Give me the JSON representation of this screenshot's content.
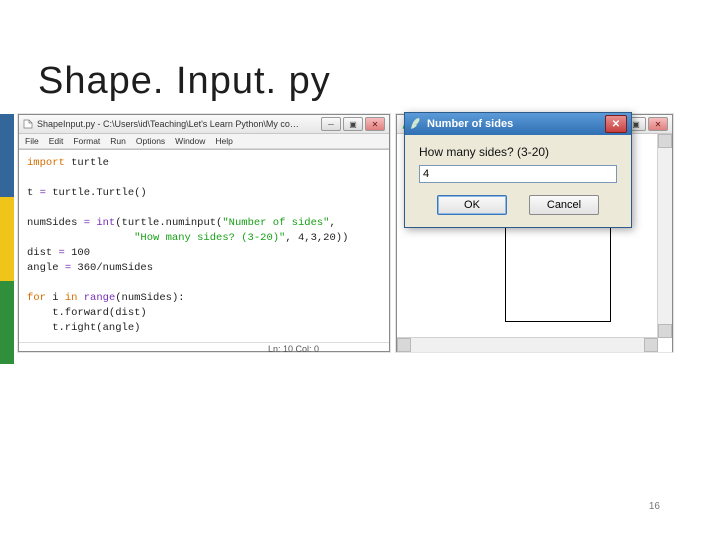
{
  "slide": {
    "heading": "Shape. Input. py",
    "page_number": "16",
    "sidebar_colors": [
      "#336699",
      "#f0c419",
      "#2f8f3a"
    ]
  },
  "editor": {
    "title": "ShapeInput.py - C:\\Users\\id\\Teaching\\Let's Learn Python\\My co…",
    "menu": [
      "File",
      "Edit",
      "Format",
      "Run",
      "Options",
      "Window",
      "Help"
    ],
    "status": "Ln: 10  Col: 0",
    "code_tokens": [
      [
        {
          "t": "import ",
          "c": "kw"
        },
        {
          "t": "turtle"
        }
      ],
      [],
      [
        {
          "t": "t "
        },
        {
          "t": "= ",
          "c": "op"
        },
        {
          "t": "turtle.Turtle()"
        }
      ],
      [],
      [
        {
          "t": "numSides "
        },
        {
          "t": "= ",
          "c": "op"
        },
        {
          "t": "int",
          "c": "fn"
        },
        {
          "t": "(turtle.numinput("
        },
        {
          "t": "\"Number of sides\"",
          "c": "str"
        },
        {
          "t": ","
        }
      ],
      [
        {
          "t": "                 "
        },
        {
          "t": "\"How many sides? (3-20)\"",
          "c": "str"
        },
        {
          "t": ", 4,3,20))"
        }
      ],
      [
        {
          "t": "dist "
        },
        {
          "t": "= ",
          "c": "op"
        },
        {
          "t": "100"
        }
      ],
      [
        {
          "t": "angle "
        },
        {
          "t": "= ",
          "c": "op"
        },
        {
          "t": "360/numSides"
        }
      ],
      [],
      [
        {
          "t": "for ",
          "c": "kw"
        },
        {
          "t": "i "
        },
        {
          "t": "in ",
          "c": "kw"
        },
        {
          "t": "range",
          "c": "fn"
        },
        {
          "t": "(numSides):"
        }
      ],
      [
        {
          "t": "    t.forward(dist)"
        }
      ],
      [
        {
          "t": "    t.right(angle)"
        }
      ]
    ],
    "win_buttons": {
      "min": "─",
      "max": "▣",
      "close": "✕"
    }
  },
  "canvas": {
    "title": "",
    "win_buttons": {
      "min": "─",
      "max": "▣",
      "close": "✕"
    }
  },
  "dialog": {
    "title": "Number of sides",
    "prompt": "How many sides? (3-20)",
    "value": "4",
    "ok": "OK",
    "cancel": "Cancel",
    "close": "✕"
  }
}
